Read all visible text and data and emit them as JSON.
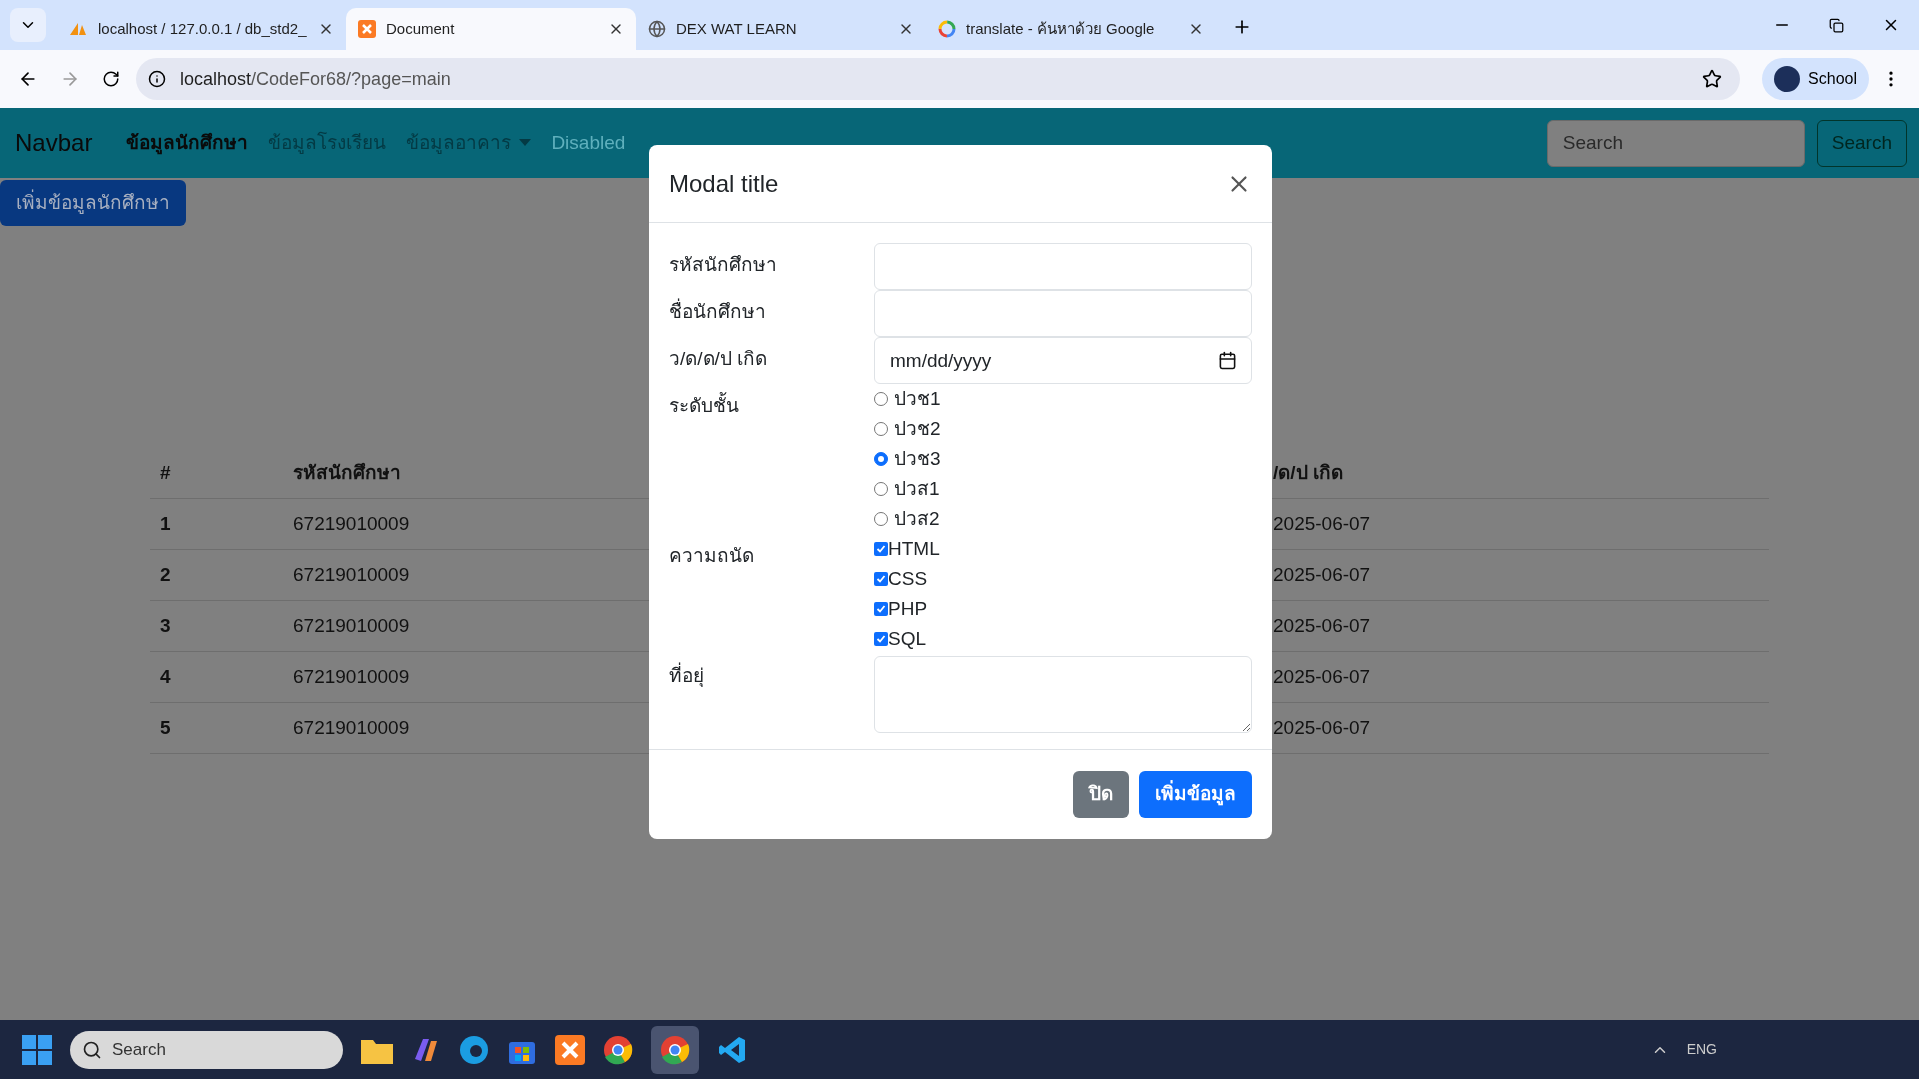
{
  "browser": {
    "tabs": [
      {
        "title": "localhost / 127.0.0.1 / db_std2_",
        "selected": false
      },
      {
        "title": "Document",
        "selected": true
      },
      {
        "title": "DEX WAT LEARN",
        "selected": false
      },
      {
        "title": "translate - ค้นหาด้วย Google",
        "selected": false
      }
    ],
    "address_host": "localhost",
    "address_path": "/CodeFor68/?page=main",
    "profile": "School"
  },
  "navbar": {
    "brand": "Navbar",
    "links": [
      {
        "label": "ข้อมูลนักศึกษา",
        "kind": "link",
        "selected": true
      },
      {
        "label": "ข้อมูลโรงเรียน",
        "kind": "link",
        "selected": false
      },
      {
        "label": "ข้อมูลอาคาร",
        "kind": "dropdown",
        "selected": false
      },
      {
        "label": "Disabled",
        "kind": "disabled",
        "selected": false
      }
    ],
    "search_placeholder": "Search",
    "search_button": "Search"
  },
  "add_button": "เพิ่มข้อมูลนักศึกษา",
  "table": {
    "columns": [
      "#",
      "รหัสนักศึกษา",
      "/ด/ป เกิด"
    ],
    "rows": [
      {
        "cells": [
          "1",
          "67219010009",
          "2025-06-07"
        ]
      },
      {
        "cells": [
          "2",
          "67219010009",
          "2025-06-07"
        ]
      },
      {
        "cells": [
          "3",
          "67219010009",
          "2025-06-07"
        ]
      },
      {
        "cells": [
          "4",
          "67219010009",
          "2025-06-07"
        ]
      },
      {
        "cells": [
          "5",
          "67219010009",
          "2025-06-07"
        ]
      }
    ]
  },
  "modal": {
    "title": "Modal title",
    "fields": [
      {
        "label": "รหัสนักศึกษา",
        "kind": "text"
      },
      {
        "label": "ชื่อนักศึกษา",
        "kind": "text"
      },
      {
        "label": "ว/ด/ด/ป เกิด",
        "kind": "date",
        "placeholder": "mm/dd/yyyy"
      },
      {
        "label": "ระดับชั้น",
        "kind": "radio",
        "options": [
          {
            "label": "ปวช1",
            "selected": false
          },
          {
            "label": "ปวช2",
            "selected": false
          },
          {
            "label": "ปวช3",
            "selected": true
          },
          {
            "label": "ปวส1",
            "selected": false
          },
          {
            "label": "ปวส2",
            "selected": false
          }
        ]
      },
      {
        "label": "ความถนัด",
        "kind": "checkbox",
        "options": [
          {
            "label": "HTML",
            "checked": true
          },
          {
            "label": "CSS",
            "checked": true
          },
          {
            "label": "PHP",
            "checked": true
          },
          {
            "label": "SQL",
            "checked": true
          }
        ]
      },
      {
        "label": "ที่อยุ่",
        "kind": "textarea"
      }
    ],
    "buttons": [
      {
        "label": "ปิด",
        "kind": "secondary"
      },
      {
        "label": "เพิ่มข้อมูล",
        "kind": "primary"
      }
    ]
  },
  "taskbar": {
    "search_placeholder": "Search",
    "language": "ENG"
  }
}
